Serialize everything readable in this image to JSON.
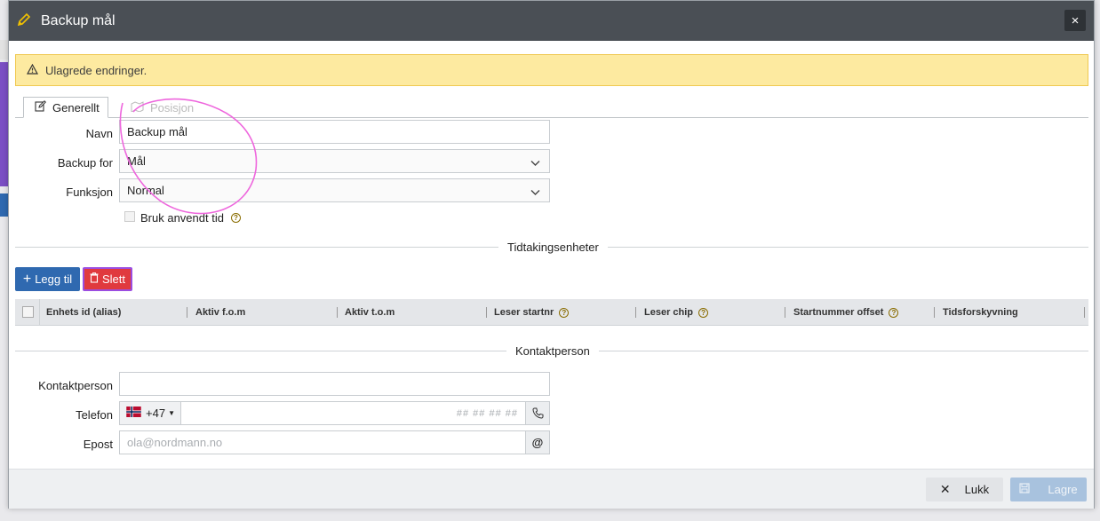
{
  "dialog": {
    "title": "Backup mål",
    "close_label": "×"
  },
  "alert": {
    "text": "Ulagrede endringer."
  },
  "tabs": [
    {
      "label": "Generellt"
    },
    {
      "label": "Posisjon"
    }
  ],
  "form": {
    "name_label": "Navn",
    "name_value": "Backup mål",
    "backup_for_label": "Backup for",
    "backup_for_value": "Mål",
    "funksjon_label": "Funksjon",
    "funksjon_value": "Normal",
    "use_time_label": "Bruk anvendt tid"
  },
  "timing_section": {
    "title": "Tidtakingsenheter",
    "add_label": "Legg til",
    "delete_label": "Slett",
    "columns": [
      "Enhets id (alias)",
      "Aktiv f.o.m",
      "Aktiv t.o.m",
      "Leser startnr",
      "Leser chip",
      "Startnummer offset",
      "Tidsforskyvning"
    ]
  },
  "contact_section": {
    "title": "Kontaktperson",
    "person_label": "Kontaktperson",
    "person_value": "",
    "phone_label": "Telefon",
    "phone_prefix": "+47",
    "phone_placeholder": "## ## ## ##",
    "email_label": "Epost",
    "email_placeholder": "ola@nordmann.no"
  },
  "footer": {
    "close_label": "Lukk",
    "save_label": "Lagre"
  },
  "colors": {
    "titlebar": "#4a4f55",
    "alert_bg": "#fdeaa0",
    "primary": "#2f69b0",
    "danger": "#e03a3e"
  }
}
